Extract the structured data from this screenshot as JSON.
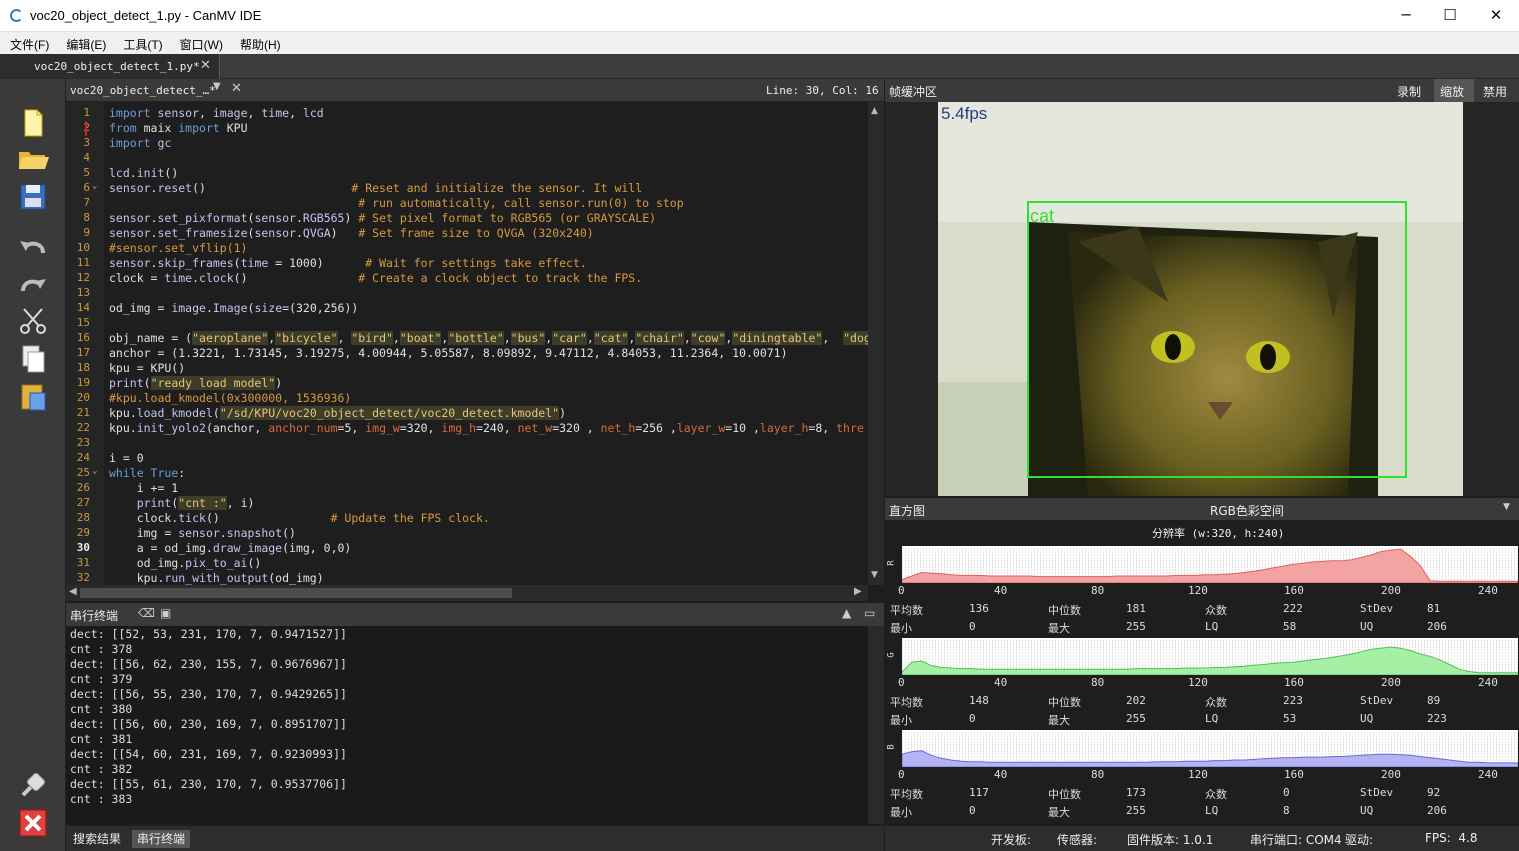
{
  "window": {
    "title": "voc20_object_detect_1.py - CanMV IDE",
    "minimize": "─",
    "maximize": "☐",
    "close": "✕"
  },
  "menu": [
    "文件(F)",
    "编辑(E)",
    "工具(T)",
    "窗口(W)",
    "帮助(H)"
  ],
  "doc_tab": {
    "label": "voc20_object_detect_1.py*",
    "close": "✕"
  },
  "editor_head": {
    "file": "voc20_object_detect_…*",
    "position": "Line: 30, Col: 16"
  },
  "code_lines": [
    [
      [
        "kw",
        "import "
      ],
      [
        "fn",
        "sensor"
      ],
      [
        "nm",
        ", "
      ],
      [
        "fn",
        "image"
      ],
      [
        "nm",
        ", "
      ],
      [
        "fn",
        "time"
      ],
      [
        "nm",
        ", "
      ],
      [
        "fn",
        "lcd"
      ]
    ],
    [
      [
        "kw",
        "from "
      ],
      [
        "nm",
        "maix "
      ],
      [
        "kw",
        "import "
      ],
      [
        "nm",
        "KPU"
      ]
    ],
    [
      [
        "kw",
        "import "
      ],
      [
        "fn",
        "gc"
      ]
    ],
    [],
    [
      [
        "fn",
        "lcd"
      ],
      [
        "nm",
        "."
      ],
      [
        "fn",
        "init"
      ],
      [
        "nm",
        "()"
      ]
    ],
    [
      [
        "fn",
        "sensor"
      ],
      [
        "nm",
        "."
      ],
      [
        "fn",
        "reset"
      ],
      [
        "nm",
        "()                     "
      ],
      [
        "cm",
        "# Reset and initialize the sensor. It will"
      ]
    ],
    [
      [
        "nm",
        "                                    "
      ],
      [
        "cm",
        "# run automatically, call sensor.run(0) to stop"
      ]
    ],
    [
      [
        "fn",
        "sensor"
      ],
      [
        "nm",
        "."
      ],
      [
        "fn",
        "set_pixformat"
      ],
      [
        "nm",
        "("
      ],
      [
        "fn",
        "sensor"
      ],
      [
        "nm",
        "."
      ],
      [
        "fn",
        "RGB565"
      ],
      [
        "nm",
        ") "
      ],
      [
        "cm",
        "# Set pixel format to RGB565 (or GRAYSCALE)"
      ]
    ],
    [
      [
        "fn",
        "sensor"
      ],
      [
        "nm",
        "."
      ],
      [
        "fn",
        "set_framesize"
      ],
      [
        "nm",
        "("
      ],
      [
        "fn",
        "sensor"
      ],
      [
        "nm",
        "."
      ],
      [
        "fn",
        "QVGA"
      ],
      [
        "nm",
        ")   "
      ],
      [
        "cm",
        "# Set frame size to QVGA (320x240)"
      ]
    ],
    [
      [
        "cm",
        "#sensor.set_vflip(1)"
      ]
    ],
    [
      [
        "fn",
        "sensor"
      ],
      [
        "nm",
        "."
      ],
      [
        "fn",
        "skip_frames"
      ],
      [
        "nm",
        "("
      ],
      [
        "fn",
        "time"
      ],
      [
        "nm",
        " = 1000)      "
      ],
      [
        "cm",
        "# Wait for settings take effect."
      ]
    ],
    [
      [
        "nm",
        "clock = "
      ],
      [
        "fn",
        "time"
      ],
      [
        "nm",
        "."
      ],
      [
        "fn",
        "clock"
      ],
      [
        "nm",
        "()                "
      ],
      [
        "cm",
        "# Create a clock object to track the FPS."
      ]
    ],
    [],
    [
      [
        "nm",
        "od_img = "
      ],
      [
        "fn",
        "image"
      ],
      [
        "nm",
        "."
      ],
      [
        "fn",
        "Image"
      ],
      [
        "nm",
        "("
      ],
      [
        "fn",
        "size"
      ],
      [
        "nm",
        "=(320,256))"
      ]
    ],
    [],
    [
      [
        "nm",
        "obj_name = ("
      ],
      [
        "st",
        "\"aeroplane\""
      ],
      [
        "nm",
        ","
      ],
      [
        "st",
        "\"bicycle\""
      ],
      [
        "nm",
        ", "
      ],
      [
        "st",
        "\"bird\""
      ],
      [
        "nm",
        ","
      ],
      [
        "st",
        "\"boat\""
      ],
      [
        "nm",
        ","
      ],
      [
        "st",
        "\"bottle\""
      ],
      [
        "nm",
        ","
      ],
      [
        "st",
        "\"bus\""
      ],
      [
        "nm",
        ","
      ],
      [
        "st",
        "\"car\""
      ],
      [
        "nm",
        ","
      ],
      [
        "st",
        "\"cat\""
      ],
      [
        "nm",
        ","
      ],
      [
        "st",
        "\"chair\""
      ],
      [
        "nm",
        ","
      ],
      [
        "st",
        "\"cow\""
      ],
      [
        "nm",
        ","
      ],
      [
        "st",
        "\"diningtable\""
      ],
      [
        "nm",
        ",  "
      ],
      [
        "st",
        "\"dog"
      ]
    ],
    [
      [
        "nm",
        "anchor = (1.3221, 1.73145, 3.19275, 4.00944, 5.05587, 8.09892, 9.47112, 4.84053, 11.2364, 10.0071)"
      ]
    ],
    [
      [
        "nm",
        "kpu = KPU()"
      ]
    ],
    [
      [
        "fn",
        "print"
      ],
      [
        "nm",
        "("
      ],
      [
        "st",
        "\"ready load model\""
      ],
      [
        "nm",
        ")"
      ]
    ],
    [
      [
        "cm",
        "#kpu.load_kmodel(0x300000, 1536936)"
      ]
    ],
    [
      [
        "nm",
        "kpu."
      ],
      [
        "fn",
        "load_kmodel"
      ],
      [
        "nm",
        "("
      ],
      [
        "st",
        "\"/sd/KPU/voc20_object_detect/voc20_detect.kmodel\""
      ],
      [
        "nm",
        ")"
      ]
    ],
    [
      [
        "nm",
        "kpu."
      ],
      [
        "fn",
        "init_yolo2"
      ],
      [
        "nm",
        "(anchor, "
      ],
      [
        "pr",
        "anchor_num"
      ],
      [
        "nm",
        "=5, "
      ],
      [
        "pr",
        "img_w"
      ],
      [
        "nm",
        "=320, "
      ],
      [
        "pr",
        "img_h"
      ],
      [
        "nm",
        "=240, "
      ],
      [
        "pr",
        "net_w"
      ],
      [
        "nm",
        "=320 , "
      ],
      [
        "pr",
        "net_h"
      ],
      [
        "nm",
        "=256 ,"
      ],
      [
        "pr",
        "layer_w"
      ],
      [
        "nm",
        "=10 ,"
      ],
      [
        "pr",
        "layer_h"
      ],
      [
        "nm",
        "=8, "
      ],
      [
        "pr",
        "thre"
      ]
    ],
    [],
    [
      [
        "nm",
        "i = 0"
      ]
    ],
    [
      [
        "kw",
        "while "
      ],
      [
        "kw",
        "True"
      ],
      [
        "nm",
        ":"
      ]
    ],
    [
      [
        "nm",
        "    i += 1"
      ]
    ],
    [
      [
        "nm",
        "    "
      ],
      [
        "fn",
        "print"
      ],
      [
        "nm",
        "("
      ],
      [
        "st",
        "\"cnt :\""
      ],
      [
        "nm",
        ", i)"
      ]
    ],
    [
      [
        "nm",
        "    clock."
      ],
      [
        "fn",
        "tick"
      ],
      [
        "nm",
        "()                "
      ],
      [
        "cm",
        "# Update the FPS clock."
      ]
    ],
    [
      [
        "nm",
        "    img = "
      ],
      [
        "fn",
        "sensor"
      ],
      [
        "nm",
        "."
      ],
      [
        "fn",
        "snapshot"
      ],
      [
        "nm",
        "()"
      ]
    ],
    [
      [
        "nm",
        "    a = od_img."
      ],
      [
        "fn",
        "draw_image"
      ],
      [
        "nm",
        "(img, 0,0)"
      ]
    ],
    [
      [
        "nm",
        "    od_img."
      ],
      [
        "fn",
        "pix_to_ai"
      ],
      [
        "nm",
        "()"
      ]
    ],
    [
      [
        "nm",
        "    kpu."
      ],
      [
        "fn",
        "run_with_output"
      ],
      [
        "nm",
        "(od_img)"
      ]
    ]
  ],
  "terminal": {
    "title": "串行终端",
    "lines": [
      "dect: [[52, 53, 231, 170, 7, 0.9471527]]",
      "cnt : 378",
      "dect: [[56, 62, 230, 155, 7, 0.9676967]]",
      "cnt : 379",
      "dect: [[56, 55, 230, 170, 7, 0.9429265]]",
      "cnt : 380",
      "dect: [[56, 60, 230, 169, 7, 0.8951707]]",
      "cnt : 381",
      "dect: [[54, 60, 231, 169, 7, 0.9230993]]",
      "cnt : 382",
      "dect: [[55, 61, 230, 170, 7, 0.9537706]]",
      "cnt : 383"
    ]
  },
  "bottom_tabs": [
    "搜索结果",
    "串行终端"
  ],
  "framebuffer": {
    "title": "帧缓冲区",
    "record": "录制",
    "zoom": "缩放",
    "disable": "禁用",
    "fps_overlay": "5.4fps",
    "label": "cat"
  },
  "histogram": {
    "title": "直方图",
    "colorspace": "RGB色彩空间",
    "resolution": "分辨率 (w:320, h:240)",
    "ticks": [
      "0",
      "40",
      "80",
      "120",
      "160",
      "200",
      "240"
    ],
    "labels": {
      "mean": "平均数",
      "median": "中位数",
      "mode": "众数",
      "stdev": "StDev",
      "min": "最小",
      "max": "最大",
      "lq": "LQ",
      "uq": "UQ"
    },
    "channels": [
      {
        "name": "R",
        "color": "#f4a3a3",
        "stroke": "#e06060",
        "mean": "136",
        "median": "181",
        "mode": "222",
        "stdev": "81",
        "min": "0",
        "max": "255",
        "lq": "58",
        "uq": "206"
      },
      {
        "name": "G",
        "color": "#a6f0a6",
        "stroke": "#55c055",
        "mean": "148",
        "median": "202",
        "mode": "223",
        "stdev": "89",
        "min": "0",
        "max": "255",
        "lq": "53",
        "uq": "223"
      },
      {
        "name": "B",
        "color": "#b4b4f4",
        "stroke": "#6a6ad8",
        "mean": "117",
        "median": "173",
        "mode": "0",
        "stdev": "92",
        "min": "0",
        "max": "255",
        "lq": "8",
        "uq": "206"
      }
    ]
  },
  "status": {
    "board": "开发板:",
    "sensor": "传感器:",
    "firmware": "固件版本: 1.0.1",
    "port": "串行端口: COM4",
    "driver": "驱动:",
    "fps": "FPS:  4.8"
  }
}
